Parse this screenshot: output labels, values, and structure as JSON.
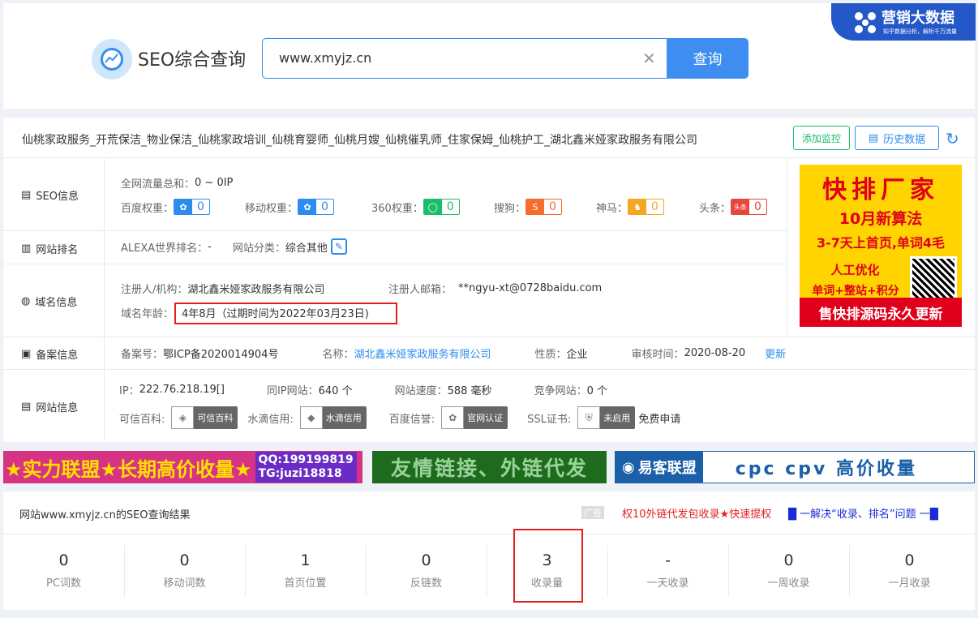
{
  "header": {
    "title": "SEO综合查询",
    "search_value": "www.xmyjz.cn",
    "search_button": "查询",
    "brand": "营销大数据",
    "brand_sub": "知乎数据分析，解析千万流量"
  },
  "site": {
    "title": "仙桃家政服务_开荒保洁_物业保洁_仙桃家政培训_仙桃育婴师_仙桃月嫂_仙桃催乳师_住家保姆_仙桃护工_湖北鑫米娅家政服务有限公司",
    "add_monitor": "添加监控",
    "history": "历史数据"
  },
  "seo_info": {
    "label": "SEO信息",
    "traffic_label": "全网流量总和：",
    "traffic_value": "0 ~ 0IP",
    "weights": [
      {
        "name": "百度权重：",
        "value": "0",
        "color": "#2d8cf0"
      },
      {
        "name": "移动权重：",
        "value": "0",
        "color": "#2d8cf0"
      },
      {
        "name": "360权重：",
        "value": "0",
        "color": "#19be6b"
      },
      {
        "name": "搜狗：",
        "value": "0",
        "color": "#f56c2d"
      },
      {
        "name": "神马：",
        "value": "0",
        "color": "#f5a623"
      },
      {
        "name": "头条：",
        "value": "0",
        "color": "#e8463c"
      }
    ]
  },
  "ranking": {
    "label": "网站排名",
    "alexa_label": "ALEXA世界排名：",
    "alexa_value": "-",
    "category_label": "网站分类：",
    "category_value": "综合其他"
  },
  "domain": {
    "label": "域名信息",
    "registrant_label": "注册人/机构：",
    "registrant_value": "湖北鑫米娅家政服务有限公司",
    "email_label": "注册人邮箱：",
    "email_value": "**ngyu-xt@0728baidu.com",
    "age_label": "域名年龄：",
    "age_value": "4年8月（过期时间为2022年03月23日)"
  },
  "icp": {
    "label": "备案信息",
    "no_label": "备案号：",
    "no_value": "鄂ICP备2020014904号",
    "name_label": "名称：",
    "name_value": "湖北鑫米娅家政服务有限公司",
    "type_label": "性质：",
    "type_value": "企业",
    "date_label": "审核时间：",
    "date_value": "2020-08-20",
    "update": "更新"
  },
  "website": {
    "label": "网站信息",
    "ip_label": "IP：",
    "ip_value": "222.76.218.19[]",
    "sameip_label": "同IP网站：",
    "sameip_value": "640 个",
    "speed_label": "网站速度：",
    "speed_value": "588 毫秒",
    "compete_label": "竞争网站：",
    "compete_value": "0 个",
    "kexin_label": "可信百科:",
    "kexin_badge": "可信百科",
    "shuidi_label": "水滴信用:",
    "shuidi_badge": "水滴信用",
    "baidu_label": "百度信誉:",
    "baidu_badge": "官网认证",
    "ssl_label": "SSL证书:",
    "ssl_badge": "未启用",
    "free_apply": "免费申请"
  },
  "ad_right": {
    "l1": "快排厂家",
    "l2": "10月新算法",
    "l3": "3-7天上首页,单词4毛",
    "l4": "人工优化",
    "l5": "单词+整站+积分",
    "l6": "售快排源码永久更新"
  },
  "banners": {
    "b1": "★实力联盟★长期高价收量★",
    "b1_qq": "QQ:199199819",
    "b1_tg": "TG:juzi18818",
    "b2": "友情链接、外链代发",
    "b3_brand": "易客联盟",
    "b3_text": "cpc cpv  高价收量"
  },
  "results": {
    "title": "网站www.xmyjz.cn的SEO查询结果",
    "ad": "广告",
    "link1": "权10外链代发包收录★快速提权",
    "link2": "█ 一解决“收录、排名”问题 一█",
    "stats": [
      {
        "value": "0",
        "label": "PC词数"
      },
      {
        "value": "0",
        "label": "移动词数"
      },
      {
        "value": "1",
        "label": "首页位置"
      },
      {
        "value": "0",
        "label": "反链数"
      },
      {
        "value": "3",
        "label": "收录量"
      },
      {
        "value": "-",
        "label": "一天收录"
      },
      {
        "value": "0",
        "label": "一周收录"
      },
      {
        "value": "0",
        "label": "一月收录"
      }
    ]
  }
}
